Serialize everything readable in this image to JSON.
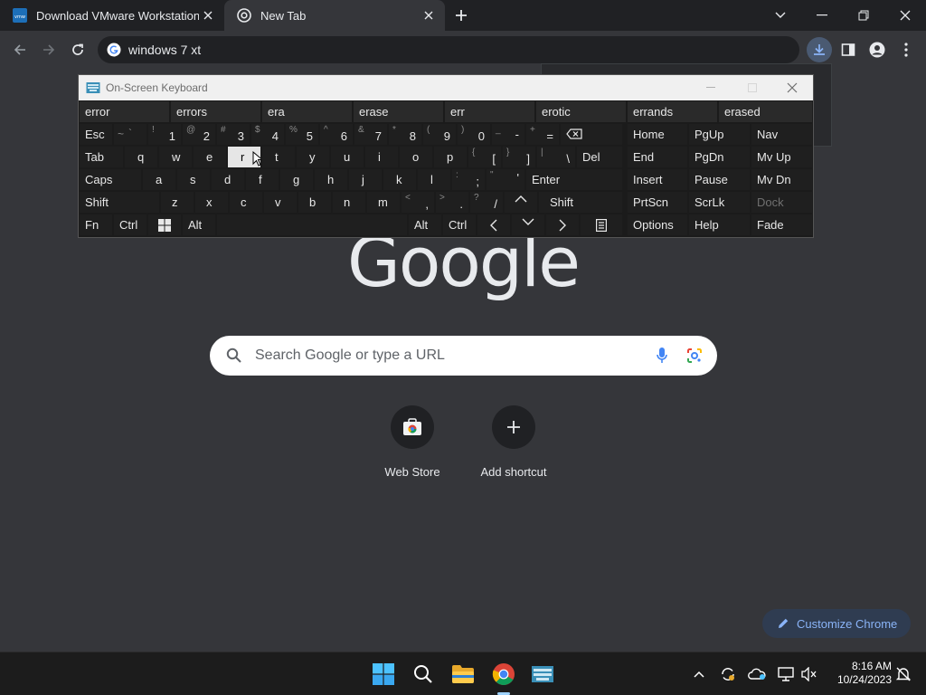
{
  "browser": {
    "tabs": [
      {
        "title": "Download VMware Workstation",
        "active": false
      },
      {
        "title": "New Tab",
        "active": true
      }
    ],
    "omnibox_value": "windows 7 xt"
  },
  "newtab": {
    "logo_text": "Google",
    "search_placeholder": "Search Google or type a URL",
    "shortcuts": [
      {
        "label": "Web Store"
      },
      {
        "label": "Add shortcut"
      }
    ],
    "customize_label": "Customize Chrome"
  },
  "osk": {
    "title": "On-Screen Keyboard",
    "suggestions": [
      "error",
      "errors",
      "era",
      "erase",
      "err",
      "erotic",
      "errands",
      "erased"
    ],
    "row1": {
      "esc": "Esc",
      "keys": [
        {
          "top": "~",
          "bot": "`"
        },
        {
          "top": "!",
          "bot": "1"
        },
        {
          "top": "@",
          "bot": "2"
        },
        {
          "top": "#",
          "bot": "3"
        },
        {
          "top": "$",
          "bot": "4"
        },
        {
          "top": "%",
          "bot": "5"
        },
        {
          "top": "^",
          "bot": "6"
        },
        {
          "top": "&",
          "bot": "7"
        },
        {
          "top": "*",
          "bot": "8"
        },
        {
          "top": "(",
          "bot": "9"
        },
        {
          "top": ")",
          "bot": "0"
        },
        {
          "top": "_",
          "bot": "-"
        },
        {
          "top": "+",
          "bot": "="
        }
      ]
    },
    "row2": {
      "tab": "Tab",
      "letters": [
        "q",
        "w",
        "e",
        "r",
        "t",
        "y",
        "u",
        "i",
        "o",
        "p"
      ],
      "brackets": [
        {
          "top": "{",
          "bot": "["
        },
        {
          "top": "}",
          "bot": "]"
        },
        {
          "top": "|",
          "bot": "\\"
        }
      ],
      "del": "Del"
    },
    "row3": {
      "caps": "Caps",
      "letters": [
        "a",
        "s",
        "d",
        "f",
        "g",
        "h",
        "j",
        "k",
        "l"
      ],
      "punct": [
        {
          "top": ":",
          "bot": ";"
        },
        {
          "top": "\"",
          "bot": "'"
        }
      ],
      "enter": "Enter"
    },
    "row4": {
      "shift_left": "Shift",
      "letters": [
        "z",
        "x",
        "c",
        "v",
        "b",
        "n",
        "m"
      ],
      "punct": [
        {
          "top": "<",
          "bot": ","
        },
        {
          "top": ">",
          "bot": "."
        },
        {
          "top": "?",
          "bot": "/"
        }
      ],
      "shift_right": "Shift"
    },
    "row5": {
      "fn": "Fn",
      "ctrl_left": "Ctrl",
      "alt_left": "Alt",
      "alt_right": "Alt",
      "ctrl_right": "Ctrl"
    },
    "side": {
      "home": "Home",
      "pgup": "PgUp",
      "nav": "Nav",
      "end": "End",
      "pgdn": "PgDn",
      "mvup": "Mv Up",
      "insert": "Insert",
      "pause": "Pause",
      "mvdn": "Mv Dn",
      "prtscn": "PrtScn",
      "scrlk": "ScrLk",
      "dock": "Dock",
      "options": "Options",
      "help": "Help",
      "fade": "Fade"
    },
    "highlighted_key": "r"
  },
  "taskbar": {
    "time": "8:16 AM",
    "date": "10/24/2023"
  },
  "colors": {
    "chrome_bg": "#35363a",
    "tabstrip_bg": "#202124",
    "accent": "#8ab4f8",
    "osk_key": "#1f1f1f"
  }
}
